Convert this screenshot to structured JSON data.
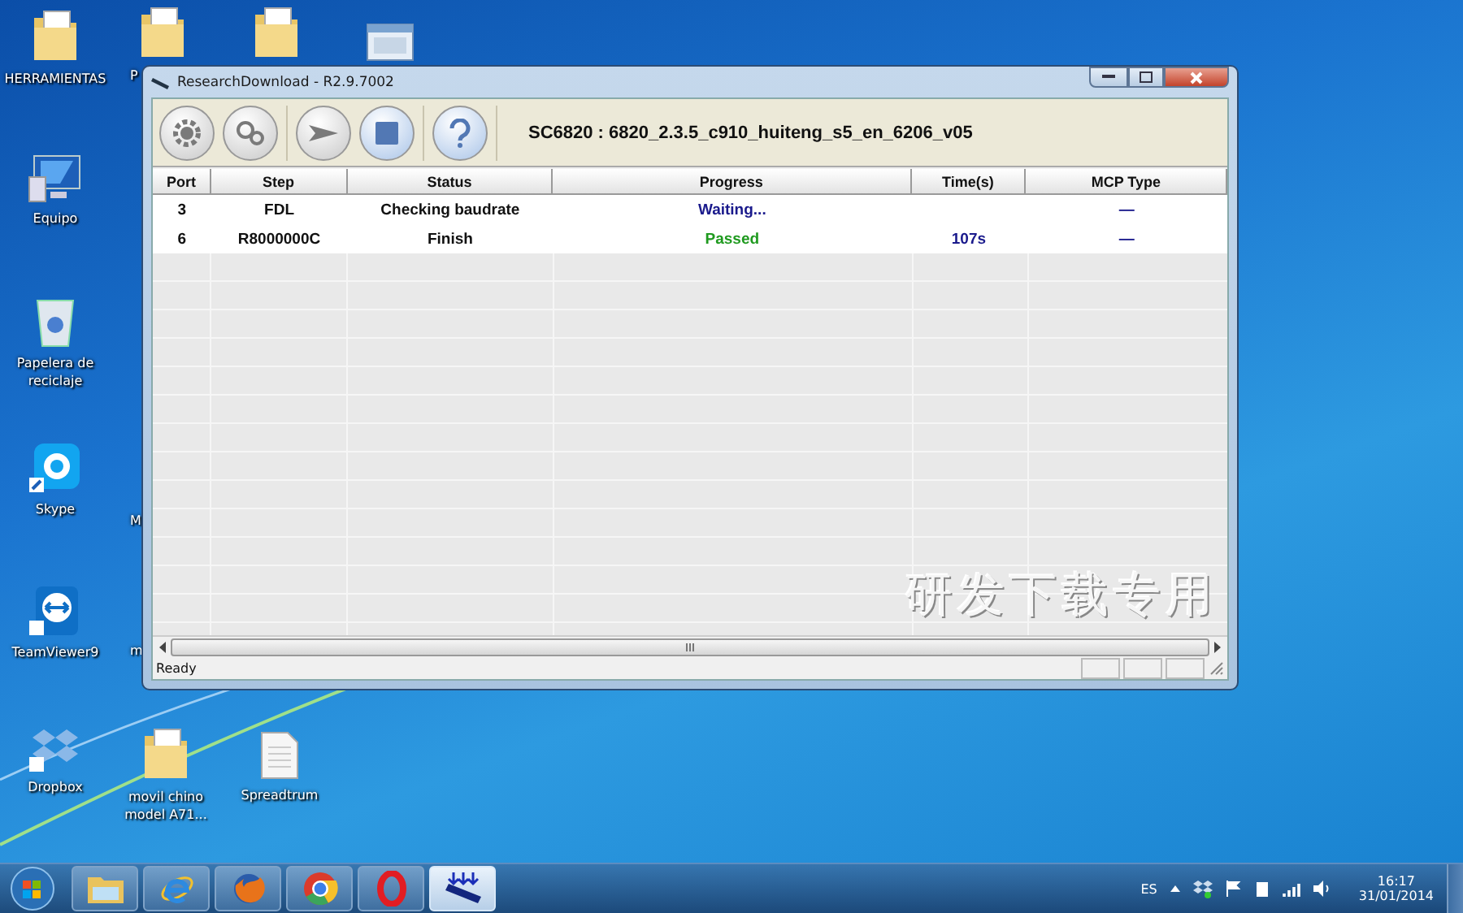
{
  "desktop": {
    "icons": [
      {
        "kind": "folder",
        "label": "HERRAMIENTAS"
      },
      {
        "kind": "folder",
        "label": "P"
      },
      {
        "kind": "folder"
      },
      {
        "kind": "window"
      },
      {
        "kind": "computer",
        "label": "Equipo"
      },
      {
        "kind": "recycle",
        "label": "Papelera de reciclaje"
      },
      {
        "kind": "skype",
        "label": "Skype"
      },
      {
        "kind": "hidden",
        "label": "M"
      },
      {
        "kind": "teamviewer",
        "label": "TeamViewer9"
      },
      {
        "kind": "hidden",
        "label": "m"
      },
      {
        "kind": "dropbox",
        "label": "Dropbox"
      },
      {
        "kind": "folder",
        "label": "movil chino model A71..."
      },
      {
        "kind": "file",
        "label": "Spreadtrum"
      }
    ]
  },
  "window": {
    "title": "ResearchDownload - R2.9.7002",
    "toolbar": {
      "buttons": [
        {
          "kind": "settings",
          "disabled": true
        },
        {
          "kind": "gears",
          "disabled": true
        },
        {
          "kind": "start",
          "disabled": true
        },
        {
          "kind": "stop",
          "disabled": false
        },
        {
          "kind": "help",
          "disabled": false
        }
      ],
      "firmware": "SC6820 : 6820_2.3.5_c910_huiteng_s5_en_6206_v05"
    },
    "table": {
      "columns": [
        "Port",
        "Step",
        "Status",
        "Progress",
        "Time(s)",
        "MCP Type"
      ],
      "rows": [
        {
          "port": "3",
          "step": "FDL",
          "status": "Checking baudrate",
          "progress": "Waiting...",
          "color": "#1a1a8c",
          "mcp_type": "—"
        },
        {
          "port": "6",
          "step": "R8000000C",
          "status": "Finish",
          "progress": "Passed",
          "color": "#1f9a1f",
          "time": "107s",
          "mcp_type": "—"
        }
      ]
    },
    "watermark_text": "研发下载专用",
    "status_bar": "Ready"
  },
  "taskbar": {
    "items": [
      {
        "kind": "explorer",
        "selected": false
      },
      {
        "kind": "ie",
        "selected": false
      },
      {
        "kind": "firefox",
        "selected": false
      },
      {
        "kind": "chrome",
        "selected": false
      },
      {
        "kind": "opera",
        "selected": false
      },
      {
        "kind": "download",
        "selected": true
      }
    ],
    "language": "ES",
    "time": "16:17",
    "date": "31/01/2014"
  }
}
